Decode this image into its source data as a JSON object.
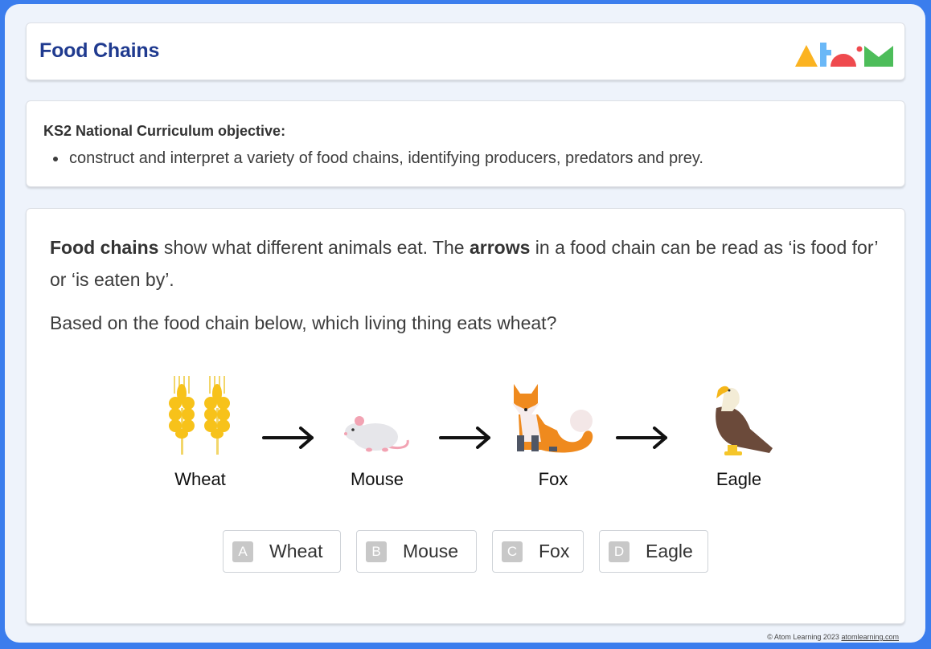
{
  "header": {
    "title": "Food Chains",
    "logo": {
      "name": "Atom",
      "colors": {
        "triangle": "#fbb321",
        "t_bar": "#6ab8f7",
        "semicircle": "#ef4a4e",
        "dot": "#ef4a4e",
        "m": "#4dbd5a"
      }
    }
  },
  "objective": {
    "heading": "KS2 National Curriculum objective:",
    "items": [
      "construct and interpret a variety of food chains, identifying producers, predators and prey."
    ]
  },
  "question": {
    "intro": {
      "bold1": "Food chains",
      "text1": " show what different animals eat. The ",
      "bold2": "arrows",
      "text2": " in a food chain can be read as ‘is food for’ or ‘is eaten by’."
    },
    "prompt": "Based on the food chain below, which living thing eats wheat?",
    "chain": [
      {
        "label": "Wheat",
        "icon": "wheat-icon"
      },
      {
        "label": "Mouse",
        "icon": "mouse-icon"
      },
      {
        "label": "Fox",
        "icon": "fox-icon"
      },
      {
        "label": "Eagle",
        "icon": "eagle-icon"
      }
    ],
    "arrow_icon": "arrow-right-icon",
    "answers": [
      {
        "letter": "A",
        "text": "Wheat"
      },
      {
        "letter": "B",
        "text": "Mouse"
      },
      {
        "letter": "C",
        "text": "Fox"
      },
      {
        "letter": "D",
        "text": "Eagle"
      }
    ]
  },
  "footer": {
    "copyright": "© Atom Learning 2023 ",
    "link_text": "atomlearning.com"
  },
  "colors": {
    "frame_border": "#3b7ded",
    "background": "#eef3fb",
    "title": "#1f3a8f",
    "answer_badge": "#c8c8c8"
  }
}
